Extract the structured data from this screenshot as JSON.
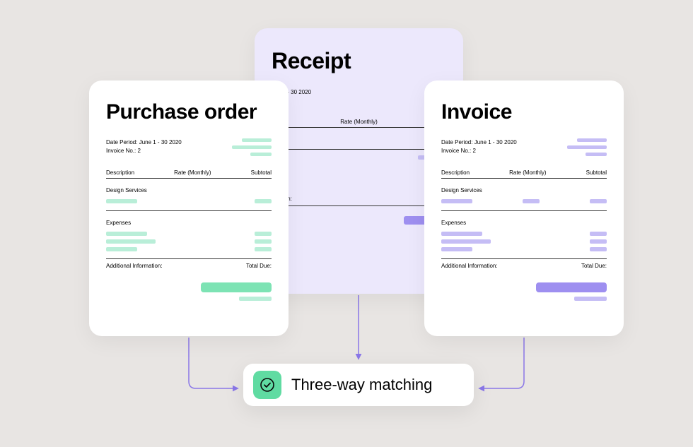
{
  "receipt": {
    "title": "Receipt",
    "date_line": "une 1 - 30 2020",
    "rate_label": "Rate (Monthly)",
    "info_label": "rmation:"
  },
  "po": {
    "title": "Purchase order",
    "date_line": "Date Period: June 1 - 30 2020",
    "invoice_line": "Invoice No.: 2",
    "col_desc": "Description",
    "col_rate": "Rate (Monthly)",
    "col_sub": "Subtotal",
    "sec_design": "Design Services",
    "sec_exp": "Expenses",
    "addl": "Additional Information:",
    "total": "Total Due:"
  },
  "invoice": {
    "title": "Invoice",
    "date_line": "Date Period: June 1 - 30 2020",
    "invoice_line": "Invoice No.: 2",
    "col_desc": "Description",
    "col_rate": "Rate (Monthly)",
    "col_sub": "Subtotal",
    "sec_design": "Design Services",
    "sec_exp": "Expenses",
    "addl": "Additional Information:",
    "total": "Total Due:"
  },
  "result": {
    "label": "Three-way matching"
  }
}
